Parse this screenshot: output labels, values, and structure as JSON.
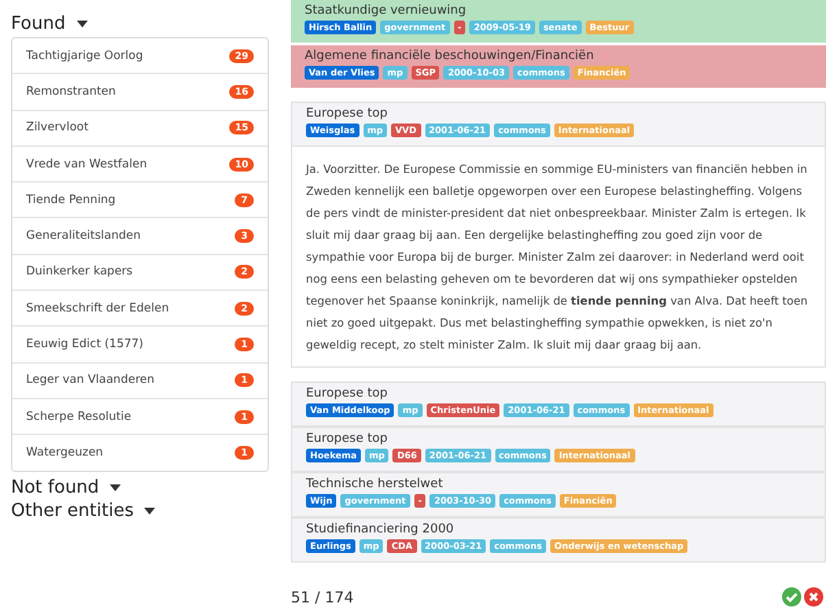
{
  "sections": [
    {
      "title": "Found",
      "items": [
        {
          "label": "Tachtigjarige Oorlog",
          "count": "29"
        },
        {
          "label": "Remonstranten",
          "count": "16"
        },
        {
          "label": "Zilvervloot",
          "count": "15"
        },
        {
          "label": "Vrede van Westfalen",
          "count": "10"
        },
        {
          "label": "Tiende Penning",
          "count": "7"
        },
        {
          "label": "Generaliteitslanden",
          "count": "3"
        },
        {
          "label": "Duinkerker kapers",
          "count": "2"
        },
        {
          "label": "Smeekschrift der Edelen",
          "count": "2"
        },
        {
          "label": "Eeuwig Edict (1577)",
          "count": "1"
        },
        {
          "label": "Leger van Vlaanderen",
          "count": "1"
        },
        {
          "label": "Scherpe Resolutie",
          "count": "1"
        },
        {
          "label": "Watergeuzen",
          "count": "1"
        }
      ]
    },
    {
      "title": "Not found"
    },
    {
      "title": "Other entities"
    }
  ],
  "results": [
    {
      "title": "Staatkundige vernieuwing",
      "kind": "accepted",
      "tags": [
        {
          "kind": "speaker",
          "text": "Hirsch Ballin"
        },
        {
          "kind": "info",
          "text": "government"
        },
        {
          "kind": "party",
          "text": "-"
        },
        {
          "kind": "info",
          "text": "2009-05-19"
        },
        {
          "kind": "info",
          "text": "senate"
        },
        {
          "kind": "topic",
          "text": "Bestuur"
        }
      ]
    },
    {
      "title": "Algemene financiële beschouwingen/Financiën",
      "kind": "rejected",
      "tags": [
        {
          "kind": "speaker",
          "text": "Van der Vlies"
        },
        {
          "kind": "info",
          "text": "mp"
        },
        {
          "kind": "party",
          "text": "SGP"
        },
        {
          "kind": "info",
          "text": "2000-10-03"
        },
        {
          "kind": "info",
          "text": "commons"
        },
        {
          "kind": "topic",
          "text": "Financiën"
        }
      ]
    },
    {
      "title": "Europese top",
      "kind": "plain",
      "tags": [
        {
          "kind": "speaker",
          "text": "Weisglas"
        },
        {
          "kind": "info",
          "text": "mp"
        },
        {
          "kind": "party",
          "text": "VVD"
        },
        {
          "kind": "info",
          "text": "2001-06-21"
        },
        {
          "kind": "info",
          "text": "commons"
        },
        {
          "kind": "topic",
          "text": "Internationaal"
        }
      ],
      "text": "Ja. Voorzitter. De Europese Commissie en sommige EU-ministers van financiën hebben in Zweden kennelijk een balletje opgeworpen over een Europese belastingheffing. Volgens de pers vindt de minister-president dat niet onbespreekbaar. Minister Zalm is ertegen. Ik sluit mij daar graag bij aan. Een dergelijke belastingheffing zou goed zijn voor de sympathie voor Europa bij de burger. Minister Zalm zei daarover: in Nederland werd ooit nog eens een belasting geheven om te bevorderen dat wij ons sympathieker opstelden tegenover het Spaanse koninkrijk, namelijk de **tiende penning** van Alva. Dat heeft toen niet zo goed uitgepakt. Dus met belastingheffing sympathie opwekken, is niet zo'n geweldig recept, zo stelt minister Zalm. Ik sluit mij daar graag bij aan."
    },
    {
      "title": "Europese top",
      "kind": "plain",
      "tags": [
        {
          "kind": "speaker",
          "text": "Van Middelkoop"
        },
        {
          "kind": "info",
          "text": "mp"
        },
        {
          "kind": "party",
          "text": "ChristenUnie"
        },
        {
          "kind": "info",
          "text": "2001-06-21"
        },
        {
          "kind": "info",
          "text": "commons"
        },
        {
          "kind": "topic",
          "text": "Internationaal"
        }
      ]
    },
    {
      "title": "Europese top",
      "kind": "plain",
      "tags": [
        {
          "kind": "speaker",
          "text": "Hoekema"
        },
        {
          "kind": "info",
          "text": "mp"
        },
        {
          "kind": "party",
          "text": "D66"
        },
        {
          "kind": "info",
          "text": "2001-06-21"
        },
        {
          "kind": "info",
          "text": "commons"
        },
        {
          "kind": "topic",
          "text": "Internationaal"
        }
      ]
    },
    {
      "title": "Technische herstelwet",
      "kind": "plain",
      "tags": [
        {
          "kind": "speaker",
          "text": "Wijn"
        },
        {
          "kind": "info",
          "text": "government"
        },
        {
          "kind": "party",
          "text": "-"
        },
        {
          "kind": "info",
          "text": "2003-10-30"
        },
        {
          "kind": "info",
          "text": "commons"
        },
        {
          "kind": "topic",
          "text": "Financiën"
        }
      ]
    },
    {
      "title": "Studiefinanciering 2000",
      "kind": "plain",
      "tags": [
        {
          "kind": "speaker",
          "text": "Eurlings"
        },
        {
          "kind": "info",
          "text": "mp"
        },
        {
          "kind": "party",
          "text": "CDA"
        },
        {
          "kind": "info",
          "text": "2000-03-21"
        },
        {
          "kind": "info",
          "text": "commons"
        },
        {
          "kind": "topic",
          "text": "Onderwijs en wetenschap"
        }
      ]
    }
  ],
  "pager": "51 / 174"
}
